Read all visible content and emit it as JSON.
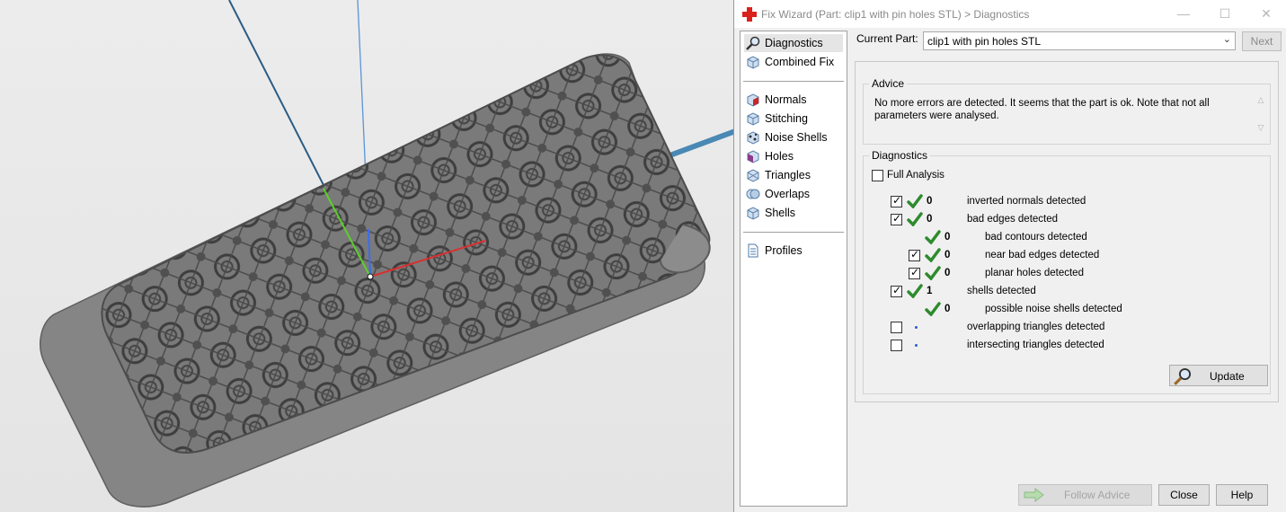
{
  "window": {
    "title": "Fix Wizard (Part: clip1 with pin holes STL) > Diagnostics",
    "minimize_glyph": "—",
    "maximize_glyph": "☐",
    "close_glyph": "✕"
  },
  "nav": {
    "items": [
      {
        "label": "Diagnostics",
        "icon": "magnifier-icon",
        "selected": true
      },
      {
        "label": "Combined Fix",
        "icon": "combined-fix-icon"
      },
      {
        "label": "Normals",
        "icon": "normals-cube-icon"
      },
      {
        "label": "Stitching",
        "icon": "stitching-cube-icon"
      },
      {
        "label": "Noise Shells",
        "icon": "noise-shells-icon"
      },
      {
        "label": "Holes",
        "icon": "holes-cube-icon"
      },
      {
        "label": "Triangles",
        "icon": "triangles-cube-icon"
      },
      {
        "label": "Overlaps",
        "icon": "overlaps-icon"
      },
      {
        "label": "Shells",
        "icon": "shells-cube-icon"
      },
      {
        "label": "Profiles",
        "icon": "document-icon"
      }
    ]
  },
  "part": {
    "label": "Current Part:",
    "value": "clip1 with pin holes STL",
    "next_label": "Next"
  },
  "advice": {
    "title": "Advice",
    "text": "No more errors are detected. It seems that the part is ok. Note that not all parameters were analysed."
  },
  "diagnostics": {
    "title": "Diagnostics",
    "full_analysis_label": "Full Analysis",
    "full_analysis_checked": false,
    "rows": [
      {
        "label": "inverted normals detected",
        "count": "0",
        "checked": true,
        "status": "ok"
      },
      {
        "label": "bad edges detected",
        "count": "0",
        "checked": true,
        "status": "ok"
      },
      {
        "label": "bad contours detected",
        "count": "0",
        "checked": null,
        "status": "ok"
      },
      {
        "label": "near bad edges detected",
        "count": "0",
        "checked": true,
        "status": "ok"
      },
      {
        "label": "planar holes detected",
        "count": "0",
        "checked": true,
        "status": "ok"
      },
      {
        "label": "shells detected",
        "count": "1",
        "checked": true,
        "status": "ok"
      },
      {
        "label": "possible noise shells detected",
        "count": "0",
        "checked": null,
        "status": "ok"
      },
      {
        "label": "overlapping triangles detected",
        "count": "",
        "checked": false,
        "status": "pending"
      },
      {
        "label": "intersecting triangles detected",
        "count": "",
        "checked": false,
        "status": "pending"
      }
    ],
    "update_label": "Update"
  },
  "buttons": {
    "follow_advice": "Follow Advice",
    "close": "Close",
    "help": "Help"
  },
  "colors": {
    "check_green": "#2e8b2e",
    "pending_blue": "#2a5bd7",
    "app_red": "#d9221c",
    "part_gray": "#6e6e6e"
  }
}
